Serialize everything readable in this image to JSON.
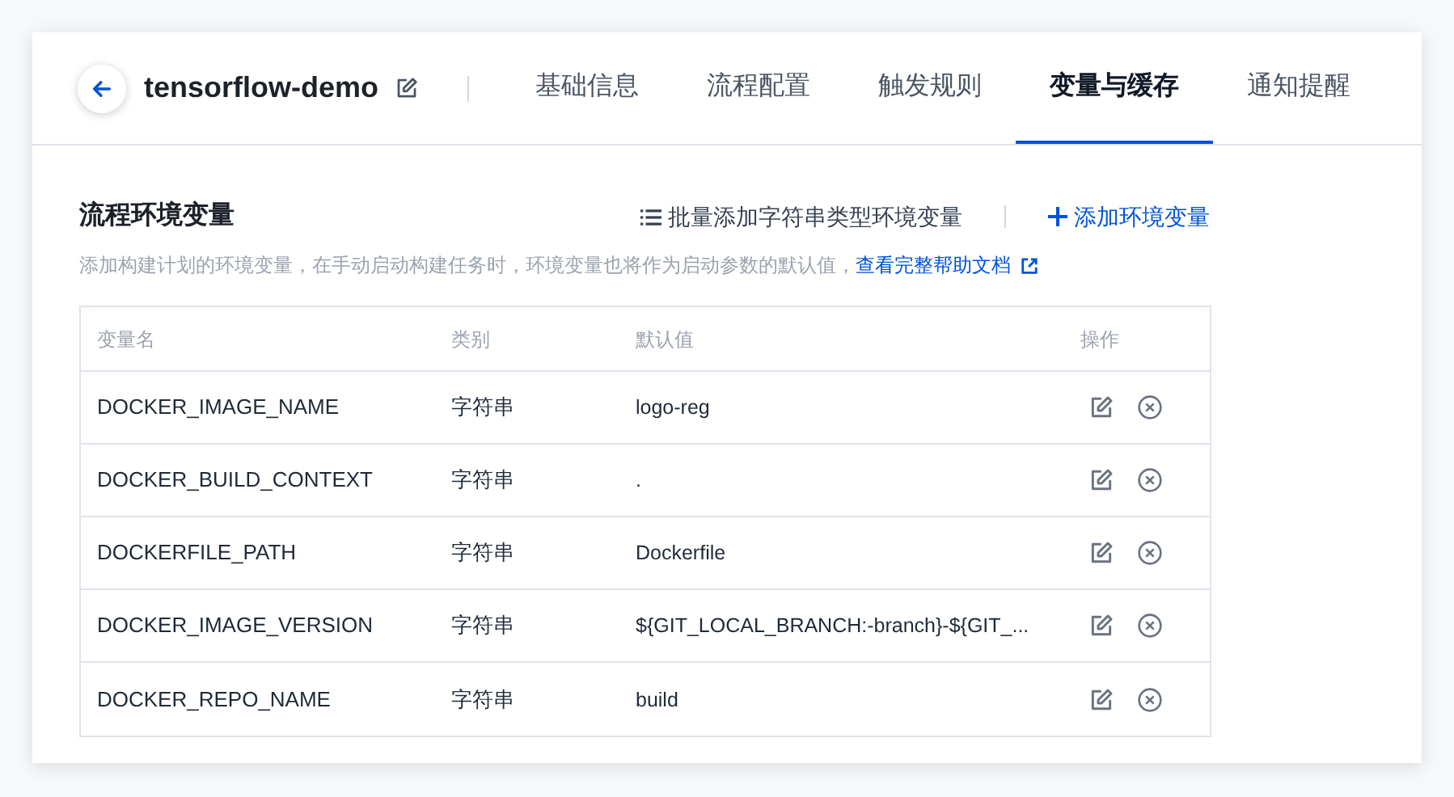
{
  "header": {
    "title": "tensorflow-demo",
    "tabs": [
      {
        "label": "基础信息",
        "selected": false
      },
      {
        "label": "流程配置",
        "selected": false
      },
      {
        "label": "触发规则",
        "selected": false
      },
      {
        "label": "变量与缓存",
        "selected": true
      },
      {
        "label": "通知提醒",
        "selected": false
      }
    ]
  },
  "section": {
    "title": "流程环境变量",
    "batch_add": "批量添加字符串类型环境变量",
    "add": "添加环境变量",
    "description": "添加构建计划的环境变量，在手动启动构建任务时，环境变量也将作为启动参数的默认值，",
    "help_link": "查看完整帮助文档"
  },
  "table": {
    "columns": [
      "变量名",
      "类别",
      "默认值",
      "操作"
    ],
    "rows": [
      {
        "name": "DOCKER_IMAGE_NAME",
        "type": "字符串",
        "default": "logo-reg"
      },
      {
        "name": "DOCKER_BUILD_CONTEXT",
        "type": "字符串",
        "default": "."
      },
      {
        "name": "DOCKERFILE_PATH",
        "type": "字符串",
        "default": "Dockerfile"
      },
      {
        "name": "DOCKER_IMAGE_VERSION",
        "type": "字符串",
        "default": "${GIT_LOCAL_BRANCH:-branch}-${GIT_..."
      },
      {
        "name": "DOCKER_REPO_NAME",
        "type": "字符串",
        "default": "build"
      }
    ]
  }
}
